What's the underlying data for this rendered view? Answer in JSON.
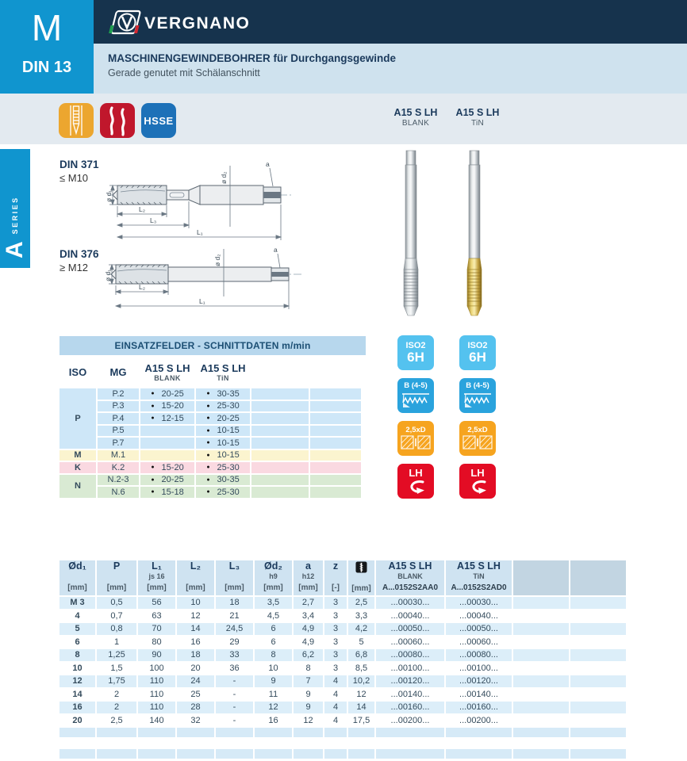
{
  "colors": {
    "brand_navy": "#16334d",
    "brand_blue": "#1095cf",
    "band_light_blue": "#cfe2ee",
    "icons_band_bg": "#e3eaf0",
    "table_title_bg": "#b7d7ed",
    "row_blue": "#cee7f8",
    "row_yellow": "#fbf4cf",
    "row_pink": "#fad9e1",
    "row_green": "#d9ead3",
    "main_header_bg": "#cfe3f1",
    "main_row_alt": "#dceef9",
    "empty_header_bg": "#c2d5e2",
    "icon_orange": "#eca62f",
    "icon_red": "#c0172c",
    "icon_hsse_blue": "#1d71b8",
    "text_navy": "#1b3a5c",
    "text_body": "#344b5c"
  },
  "header": {
    "thread_letter": "M",
    "din_standard": "DIN 13",
    "brand": "VERGNANO",
    "title": "MASCHINENGEWINDEBOHRER für Durchgangsgewinde",
    "subtitle": "Gerade genutet mit Schälanschnitt"
  },
  "icons_row": {
    "hsse_label": "HSSE",
    "variants": [
      {
        "name": "A15 S LH",
        "sub": "BLANK"
      },
      {
        "name": "A15 S LH",
        "sub": "TiN"
      }
    ]
  },
  "series_tab": {
    "letter": "A",
    "word": "SERIES"
  },
  "drawings": [
    {
      "din": "DIN 371",
      "range": "≤ M10"
    },
    {
      "din": "DIN 376",
      "range": "≥ M12"
    }
  ],
  "drawing_labels": {
    "d1": "ø d₁",
    "d2": "ø d₂",
    "l1": "L₁",
    "l2": "L₂",
    "l3": "L₃",
    "a": "a"
  },
  "cutting_table": {
    "title": "EINSATZFELDER - SCHNITTDATEN m/min",
    "col_iso": "ISO",
    "col_mg": "MG",
    "variant_cols": [
      {
        "name": "A15 S LH",
        "sub": "BLANK"
      },
      {
        "name": "A15 S LH",
        "sub": "TiN"
      }
    ],
    "groups": [
      {
        "iso": "P",
        "color": "blue",
        "rows": [
          {
            "mg": "P.2",
            "blank": "20-25",
            "tin": "30-35"
          },
          {
            "mg": "P.3",
            "blank": "15-20",
            "tin": "25-30"
          },
          {
            "mg": "P.4",
            "blank": "12-15",
            "tin": "20-25"
          },
          {
            "mg": "P.5",
            "blank": "",
            "tin": "10-15"
          },
          {
            "mg": "P.7",
            "blank": "",
            "tin": "10-15"
          }
        ]
      },
      {
        "iso": "M",
        "color": "yellow",
        "rows": [
          {
            "mg": "M.1",
            "blank": "",
            "tin": "10-15"
          }
        ]
      },
      {
        "iso": "K",
        "color": "pink",
        "rows": [
          {
            "mg": "K.2",
            "blank": "15-20",
            "tin": "25-30"
          }
        ]
      },
      {
        "iso": "N",
        "color": "green",
        "rows": [
          {
            "mg": "N.2-3",
            "blank": "20-25",
            "tin": "30-35"
          },
          {
            "mg": "N.6",
            "blank": "15-18",
            "tin": "25-30"
          }
        ]
      }
    ]
  },
  "badges": {
    "items": [
      {
        "type": "tolerance",
        "line1": "ISO2",
        "line2": "6H",
        "color": "#54c2ef"
      },
      {
        "type": "chamfer",
        "label": "B (4-5)",
        "color": "#2aa3dd"
      },
      {
        "type": "depth",
        "label": "2,5xD",
        "color": "#f6a41f"
      },
      {
        "type": "rotation",
        "label": "LH",
        "color": "#e30c24"
      }
    ]
  },
  "main_table": {
    "headers": [
      {
        "sym": "Ød₁",
        "tol": "",
        "unit": "[mm]"
      },
      {
        "sym": "P",
        "tol": "",
        "unit": "[mm]"
      },
      {
        "sym": "L₁",
        "tol": "js 16",
        "unit": "[mm]"
      },
      {
        "sym": "L₂",
        "tol": "",
        "unit": "[mm]"
      },
      {
        "sym": "L₃",
        "tol": "",
        "unit": "[mm]"
      },
      {
        "sym": "Ød₂",
        "tol": "h9",
        "unit": "[mm]"
      },
      {
        "sym": "a",
        "tol": "h12",
        "unit": "[mm]"
      },
      {
        "sym": "z",
        "tol": "",
        "unit": "[-]"
      },
      {
        "sym": "",
        "icon": "tap-drill-icon",
        "tol": "",
        "unit": "[mm]"
      }
    ],
    "order_cols": [
      {
        "name": "A15 S LH",
        "sub": "BLANK",
        "code": "A...0152S2AA0"
      },
      {
        "name": "A15 S LH",
        "sub": "TiN",
        "code": "A...0152S2AD0"
      }
    ],
    "empty_cols": 2,
    "rows": [
      {
        "cells": [
          "M 3",
          "0,5",
          "56",
          "10",
          "18",
          "3,5",
          "2,7",
          "3",
          "2,5",
          "...00030...",
          "...00030..."
        ]
      },
      {
        "cells": [
          "4",
          "0,7",
          "63",
          "12",
          "21",
          "4,5",
          "3,4",
          "3",
          "3,3",
          "...00040...",
          "...00040..."
        ]
      },
      {
        "cells": [
          "5",
          "0,8",
          "70",
          "14",
          "24,5",
          "6",
          "4,9",
          "3",
          "4,2",
          "...00050...",
          "...00050..."
        ]
      },
      {
        "cells": [
          "6",
          "1",
          "80",
          "16",
          "29",
          "6",
          "4,9",
          "3",
          "5",
          "...00060...",
          "...00060..."
        ]
      },
      {
        "cells": [
          "8",
          "1,25",
          "90",
          "18",
          "33",
          "8",
          "6,2",
          "3",
          "6,8",
          "...00080...",
          "...00080..."
        ]
      },
      {
        "cells": [
          "10",
          "1,5",
          "100",
          "20",
          "36",
          "10",
          "8",
          "3",
          "8,5",
          "...00100...",
          "...00100..."
        ]
      },
      {
        "cells": [
          "12",
          "1,75",
          "110",
          "24",
          "-",
          "9",
          "7",
          "4",
          "10,2",
          "...00120...",
          "...00120..."
        ]
      },
      {
        "cells": [
          "14",
          "2",
          "110",
          "25",
          "-",
          "11",
          "9",
          "4",
          "12",
          "...00140...",
          "...00140..."
        ]
      },
      {
        "cells": [
          "16",
          "2",
          "110",
          "28",
          "-",
          "12",
          "9",
          "4",
          "14",
          "...00160...",
          "...00160..."
        ]
      },
      {
        "cells": [
          "20",
          "2,5",
          "140",
          "32",
          "-",
          "16",
          "12",
          "4",
          "17,5",
          "...00200...",
          "...00200..."
        ]
      }
    ]
  }
}
